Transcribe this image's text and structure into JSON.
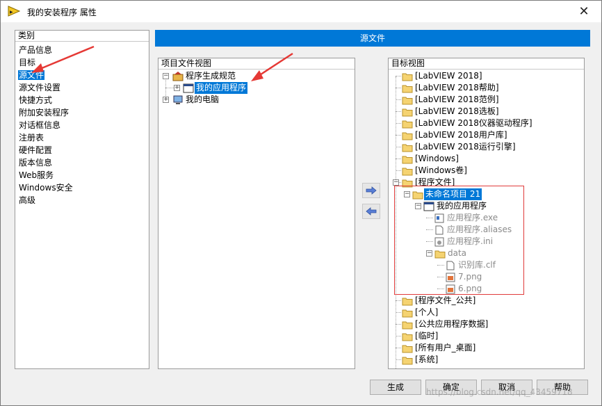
{
  "window": {
    "title": "我的安装程序 属性",
    "close_label": "✕"
  },
  "categories": {
    "header": "类别",
    "items": [
      {
        "label": "产品信息",
        "selected": false
      },
      {
        "label": "目标",
        "selected": false
      },
      {
        "label": "源文件",
        "selected": true
      },
      {
        "label": "源文件设置",
        "selected": false
      },
      {
        "label": "快捷方式",
        "selected": false
      },
      {
        "label": "附加安装程序",
        "selected": false
      },
      {
        "label": "对话框信息",
        "selected": false
      },
      {
        "label": "注册表",
        "selected": false
      },
      {
        "label": "硬件配置",
        "selected": false
      },
      {
        "label": "版本信息",
        "selected": false
      },
      {
        "label": "Web服务",
        "selected": false
      },
      {
        "label": "Windows安全",
        "selected": false
      },
      {
        "label": "高级",
        "selected": false
      }
    ]
  },
  "section_title": "源文件",
  "project_view": {
    "header": "项目文件视图",
    "nodes": [
      {
        "label": "程序生成规范",
        "icon": "build-spec-icon"
      },
      {
        "label": "我的应用程序",
        "icon": "application-icon",
        "selected": true
      },
      {
        "label": "我的电脑",
        "icon": "computer-icon"
      }
    ]
  },
  "target_view": {
    "header": "目标视图",
    "folders": [
      "[LabVIEW 2018]",
      "[LabVIEW 2018帮助]",
      "[LabVIEW 2018范例]",
      "[LabVIEW 2018选板]",
      "[LabVIEW 2018仪器驱动程序]",
      "[LabVIEW 2018用户库]",
      "[LabVIEW 2018运行引擎]",
      "[Windows]",
      "[Windows卷]",
      "[程序文件]"
    ],
    "project_folder": "未命名项目 21",
    "app_node": "我的应用程序",
    "app_files": [
      "应用程序.exe",
      "应用程序.aliases",
      "应用程序.ini"
    ],
    "data_folder": "data",
    "data_files": [
      "识别库.clf",
      "7.png",
      "6.png"
    ],
    "folders_after": [
      "[程序文件_公共]",
      "[个人]",
      "[公共应用程序数据]",
      "[临时]",
      "[所有用户_桌面]",
      "[系统]"
    ]
  },
  "buttons": {
    "build": "生成",
    "ok": "确定",
    "cancel": "取消",
    "help": "帮助"
  },
  "watermark": "https://blog.csdn.net/qq_43459718"
}
